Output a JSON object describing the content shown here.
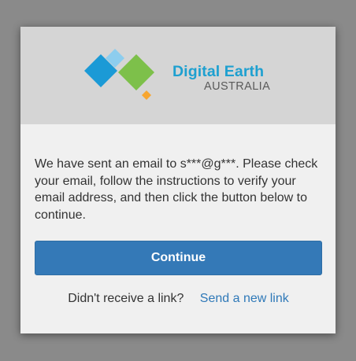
{
  "brand": {
    "title": "Digital Earth",
    "subtitle": "AUSTRALIA",
    "colors": {
      "blue": "#1b9ad6",
      "light_blue": "#8dcdee",
      "green": "#7dc04a",
      "orange": "#f7a630",
      "title_text": "#1ea0d0",
      "subtitle_text": "#5a5a5a"
    }
  },
  "message": {
    "text": "We have sent an email to s***@g***. Please check your email, follow the instructions to verify your email address, and then click the button below to continue."
  },
  "continue_button": {
    "label": "Continue",
    "color": "#3479b7"
  },
  "resend": {
    "prompt": "Didn't receive a link?",
    "link_label": "Send a new link",
    "link_color": "#2f79b8"
  }
}
